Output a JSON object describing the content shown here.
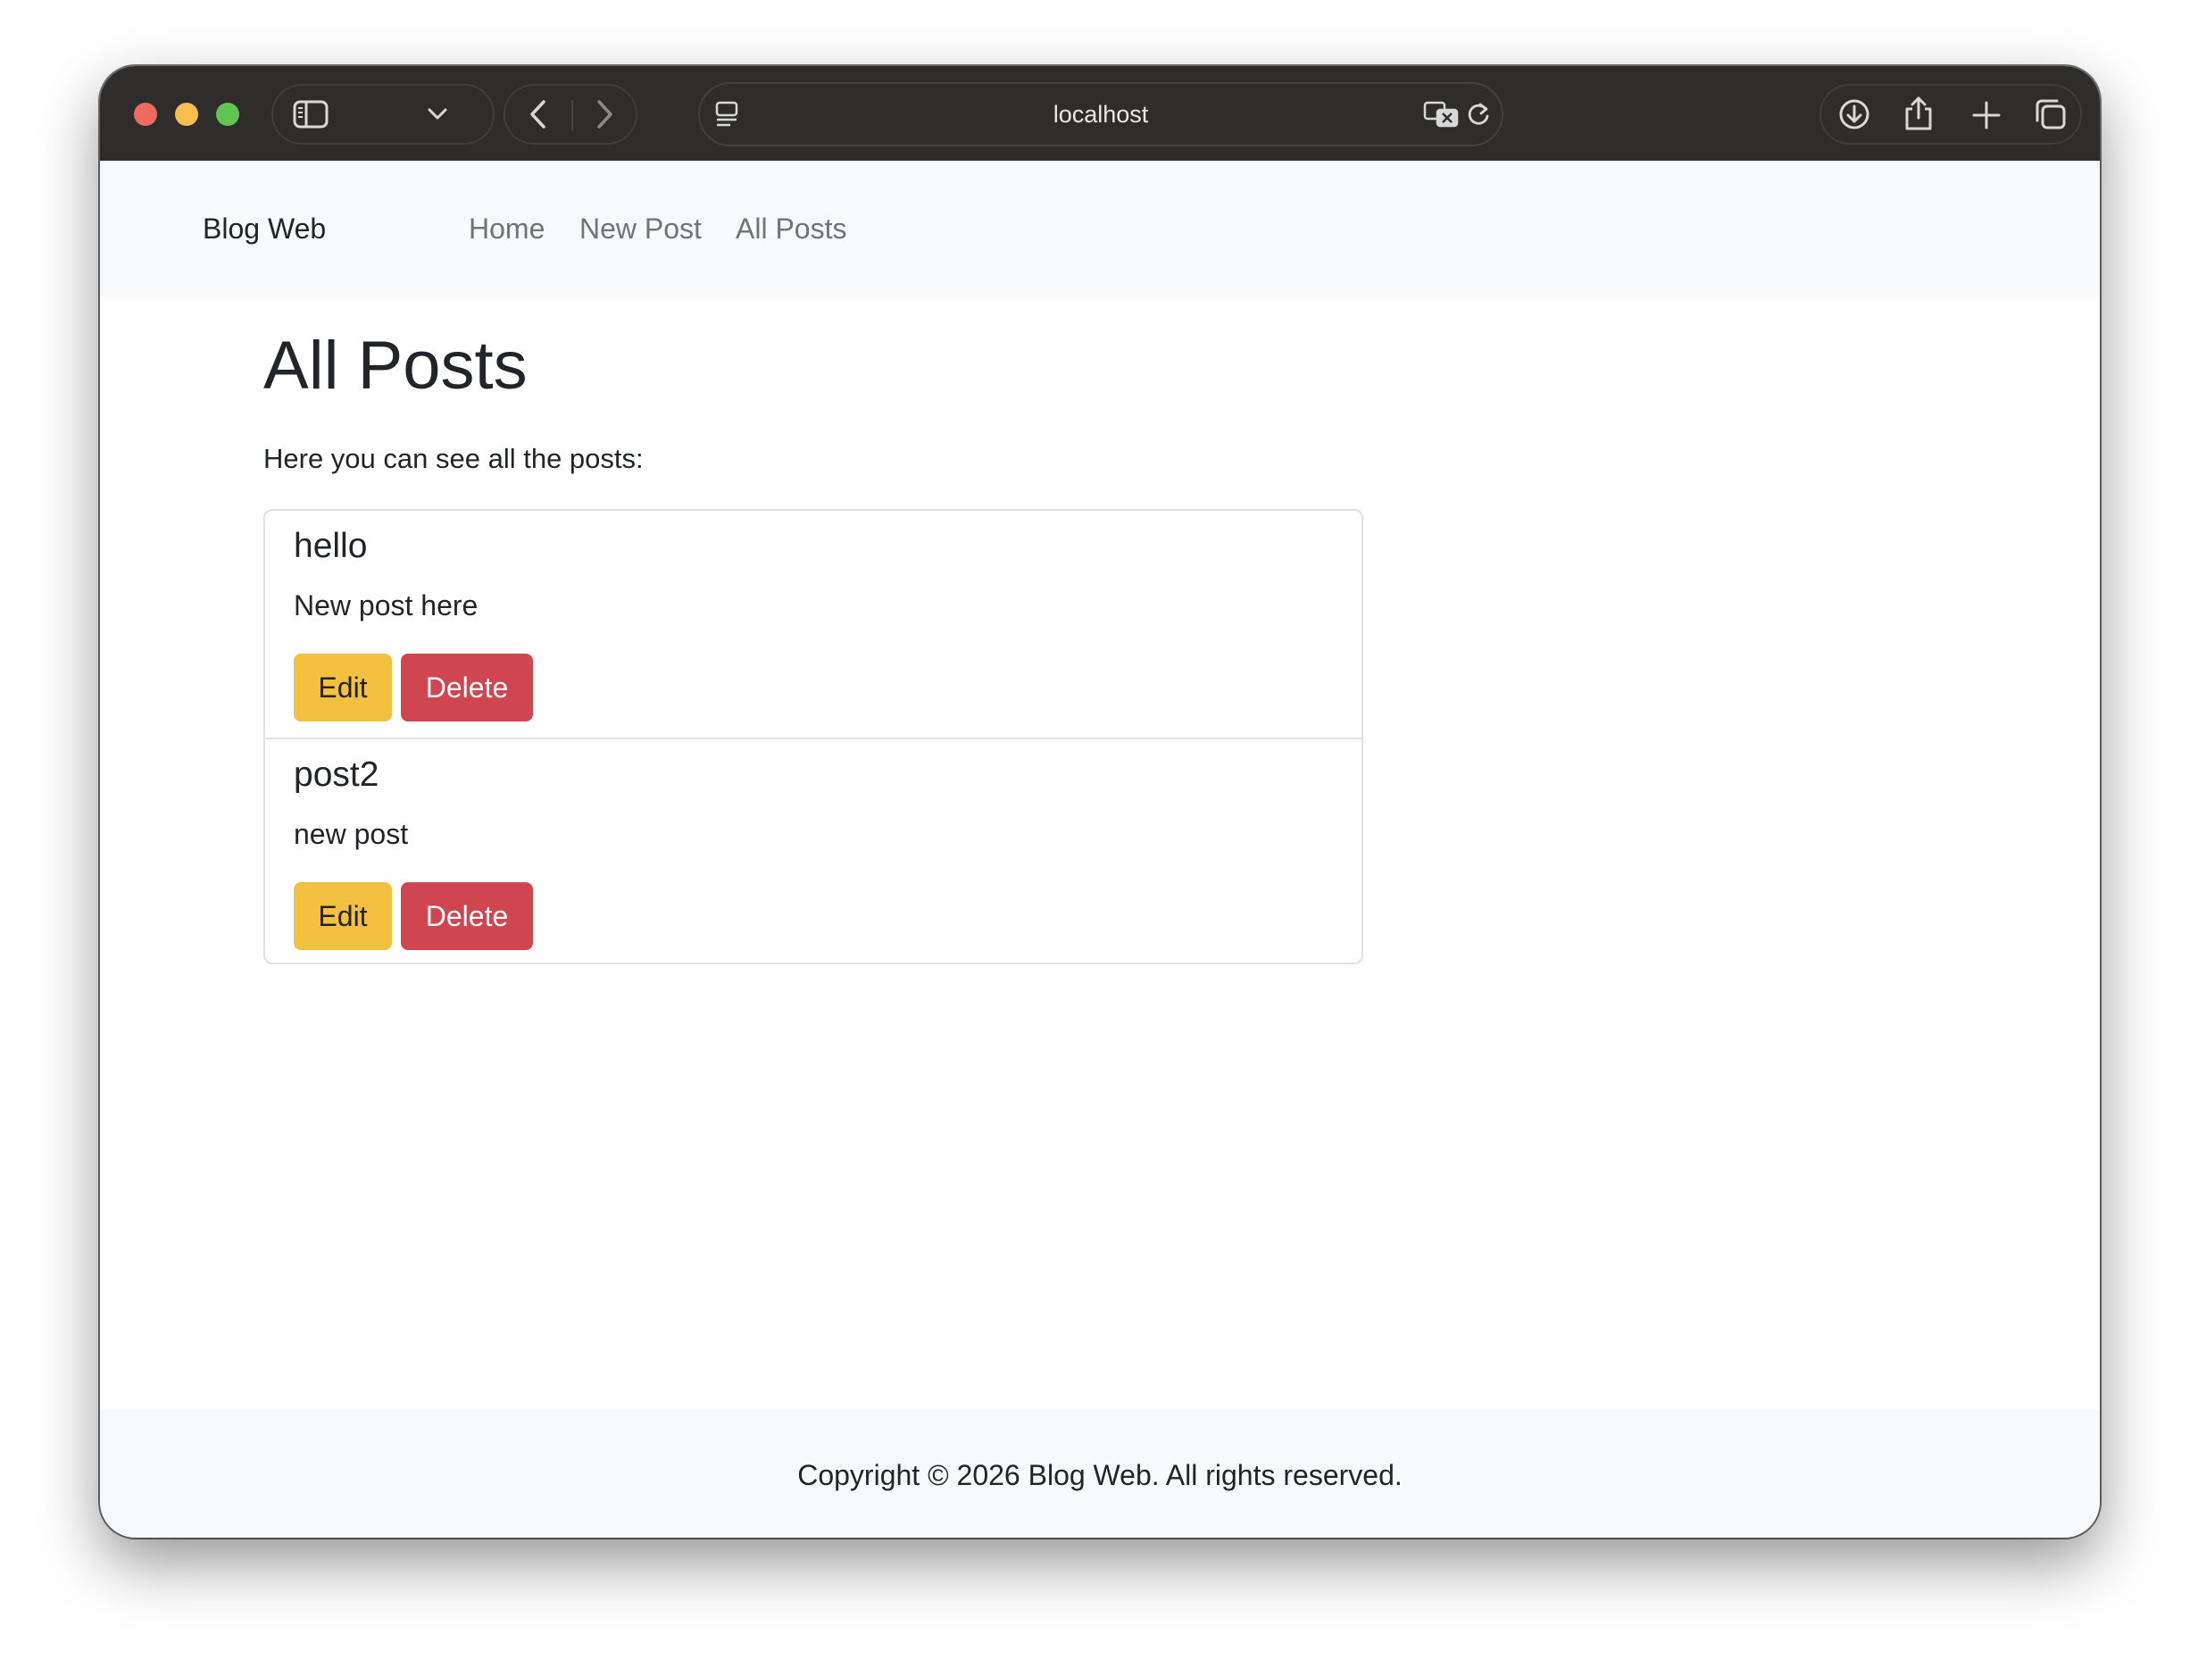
{
  "browser": {
    "url": "localhost",
    "toolbar_color": "#2e2d2b",
    "icons": {
      "sidebar": "sidebar-icon",
      "tab_menu": "chevron-down-icon",
      "back": "chevron-left-icon",
      "forward": "chevron-right-icon",
      "page": "page-menu-icon",
      "translate": "translate-icon",
      "reload": "reload-icon",
      "downloads": "download-icon",
      "share": "share-icon",
      "new_tab": "plus-icon",
      "tabs": "tab-overview-icon"
    }
  },
  "navbar": {
    "brand": "Blog Web",
    "links": [
      {
        "label": "Home"
      },
      {
        "label": "New Post"
      },
      {
        "label": "All Posts"
      }
    ]
  },
  "main": {
    "title": "All Posts",
    "lead": "Here you can see all the posts:",
    "posts": [
      {
        "title": "hello",
        "body": "New post here",
        "edit_label": "Edit",
        "delete_label": "Delete"
      },
      {
        "title": "post2",
        "body": "new post",
        "edit_label": "Edit",
        "delete_label": "Delete"
      }
    ]
  },
  "footer": {
    "text": "Copyright © 2026 Blog Web. All rights reserved."
  },
  "colors": {
    "navbar_bg": "#f8f9fa",
    "edit_button": "#f3c13f",
    "delete_button": "#cf4550",
    "border": "#dee2e6"
  }
}
